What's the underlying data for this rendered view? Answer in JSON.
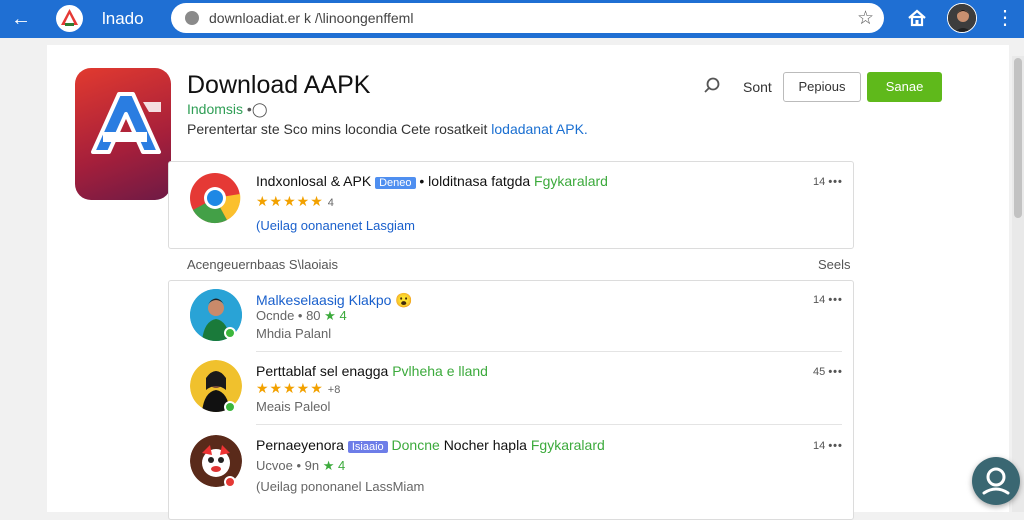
{
  "topbar": {
    "brand": "lnado",
    "url": "downloadiat.er k /\\linoongenffeml",
    "colors": {
      "bar": "#1f6fd3"
    }
  },
  "header": {
    "title": "Download AAPK",
    "subtitle": "Indomsis",
    "description_prefix": "Perentertar ste Sco mins locondia Cete rosatkeit",
    "description_link": "lodadanat",
    "description_suffix": "APK.",
    "sort_label": "Sont",
    "prev_button": "Pepious",
    "green_button": "Sanae"
  },
  "featured": {
    "title_prefix": "Indxonlosal & APK",
    "tag": "Deneo",
    "title_mid": "• lolditnasa fatgda",
    "title_green": "Fgykaralard",
    "stars": "★★★★★",
    "stars_meta": "4",
    "sub": "(Ueilag oonanenet Lasgiam",
    "side": "14",
    "rating": 5
  },
  "section": {
    "label": "Acengeuernbaas S\\laoiais",
    "right": "Seels"
  },
  "list": [
    {
      "title_blue": "Malkeselaasig Klakpo",
      "emoji": "😮",
      "meta": "Ocnde • 80",
      "meta2": "★ 4",
      "sub": "Mhdia Palanl",
      "side": "14"
    },
    {
      "title": "Perttablaf sel enagga",
      "title_green": "Pvlheha e lland",
      "stars": "★★★★★",
      "stars_meta": "+8",
      "sub": "Meais Paleol",
      "side": "45"
    },
    {
      "title": "Pernaeyenora",
      "tag": "Isiaaio",
      "title_green": "Doncne",
      "title_mid": "Nocher hapla",
      "title_green2": "Fgykaralard",
      "meta": "Ucvoe • 9n",
      "meta2": "★ 4",
      "sub": "(Ueilag pononanel LassMiam",
      "side": "14"
    }
  ]
}
